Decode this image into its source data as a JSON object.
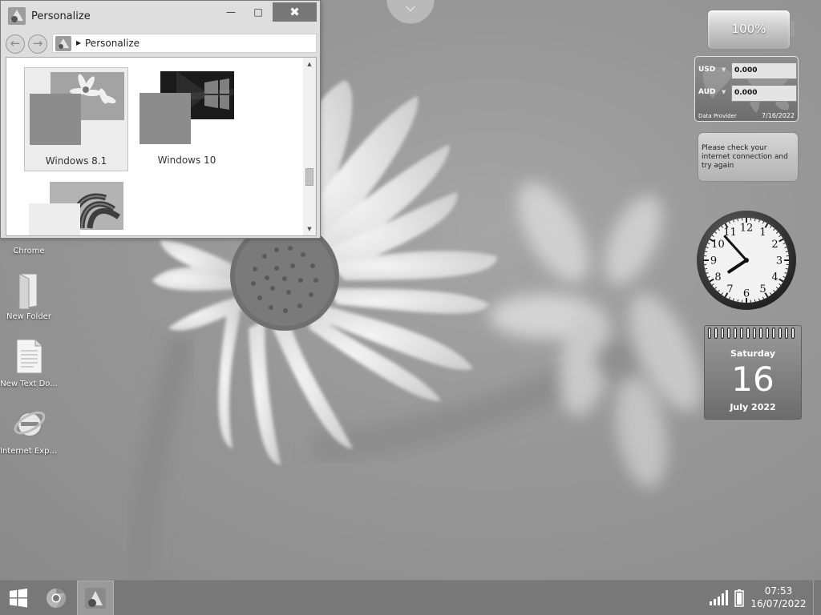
{
  "window": {
    "title": "Personalize",
    "nav_back_icon": "arrow-left-icon",
    "nav_forward_icon": "arrow-right-icon",
    "address_path": "Personalize",
    "controls": {
      "minimize": "—",
      "maximize": "□",
      "close": "✖"
    },
    "themes": [
      {
        "name": "Windows 8.1",
        "selected": true
      },
      {
        "name": "Windows 10",
        "selected": false
      },
      {
        "name": "",
        "selected": false
      }
    ]
  },
  "desktop_icons": [
    {
      "label": "Chrome",
      "icon": "chrome-icon"
    },
    {
      "label": "New Folder",
      "icon": "folder-icon"
    },
    {
      "label": "New Text Do...",
      "icon": "text-document-icon"
    },
    {
      "label": "Internet Expl...",
      "icon": "internet-explorer-icon"
    }
  ],
  "gadgets": {
    "battery": {
      "percent_text": "100%",
      "level": 1.0
    },
    "currency": {
      "rows": [
        {
          "code": "USD",
          "value": "0.000"
        },
        {
          "code": "AUD",
          "value": "0.000"
        }
      ],
      "provider": "Data Provider",
      "date": "7/16/2022"
    },
    "network_message": "Please check your internet connection and try again",
    "clock": {
      "numerals": [
        "12",
        "1",
        "2",
        "3",
        "4",
        "5",
        "6",
        "7",
        "8",
        "9",
        "10",
        "11"
      ],
      "hour": 7,
      "minute": 53
    },
    "calendar": {
      "weekday": "Saturday",
      "day": "16",
      "month_year": "July 2022"
    }
  },
  "taskbar": {
    "start_icon": "windows-start-icon",
    "pinned": [
      "chrome-icon",
      "personalize-icon"
    ],
    "tray": {
      "time": "07:53",
      "date": "16/07/2022",
      "signal_icon": "signal-bars-icon",
      "battery_icon": "battery-icon"
    }
  },
  "top_tab_icon": "chevron-down-icon"
}
